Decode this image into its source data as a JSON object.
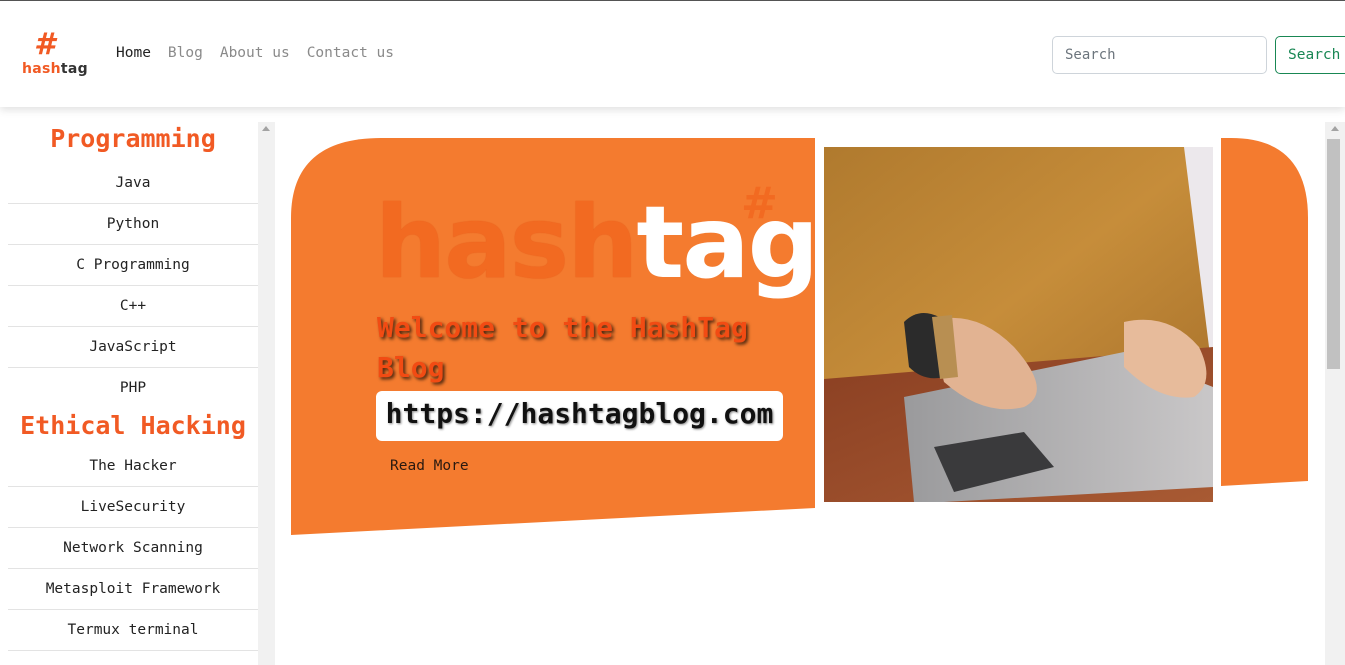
{
  "navbar": {
    "logo": {
      "symbol": "#",
      "word_part1": "hash",
      "word_part2": "tag"
    },
    "links": [
      "Home",
      "Blog",
      "About us",
      "Contact us"
    ],
    "search": {
      "placeholder": "Search",
      "value": "",
      "button_label": "Search"
    }
  },
  "sidebar": {
    "programming_title": "Programming",
    "programming_items": [
      "Java",
      "Python",
      "C Programming",
      "C++",
      "JavaScript",
      "PHP"
    ],
    "hacking_title": "Ethical Hacking",
    "hacking_items": [
      "The Hacker",
      "LiveSecurity",
      "Network Scanning",
      "Metasploit Framework",
      "Termux terminal"
    ]
  },
  "banner": {
    "big_word_part1": "hash",
    "big_word_part2": "tag",
    "big_symbol": "#",
    "welcome_text": "Welcome to the HashTag Blog",
    "url": "https://hashtagblog.com",
    "read_more_label": "Read More"
  },
  "colors": {
    "brand_orange": "#f47b2f",
    "accent_red": "#f24b13",
    "search_green": "#198754"
  }
}
